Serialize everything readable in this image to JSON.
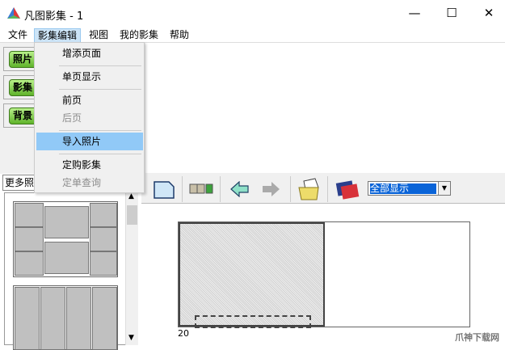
{
  "window": {
    "title": "凡图影集 - 1",
    "minimize": "—",
    "maximize": "☐",
    "close": "✕"
  },
  "menubar": [
    "文件",
    "影集编辑",
    "视图",
    "我的影集",
    "帮助"
  ],
  "dropdown_menu": [
    {
      "label": "增添页面",
      "enabled": true
    },
    {
      "label": "单页显示",
      "enabled": true
    },
    {
      "label": "前页",
      "enabled": true
    },
    {
      "label": "后页",
      "enabled": false
    },
    {
      "label": "导入照片",
      "enabled": true,
      "highlighted": true
    },
    {
      "label": "定购影集",
      "enabled": true
    },
    {
      "label": "定单查询",
      "enabled": false
    }
  ],
  "side_buttons": [
    "照片",
    "影集",
    "背景"
  ],
  "more_combo": "更多照",
  "toolbar": {
    "view_select": "全部显示"
  },
  "canvas": {
    "page_number": "20"
  },
  "watermark": "爪神下载网"
}
